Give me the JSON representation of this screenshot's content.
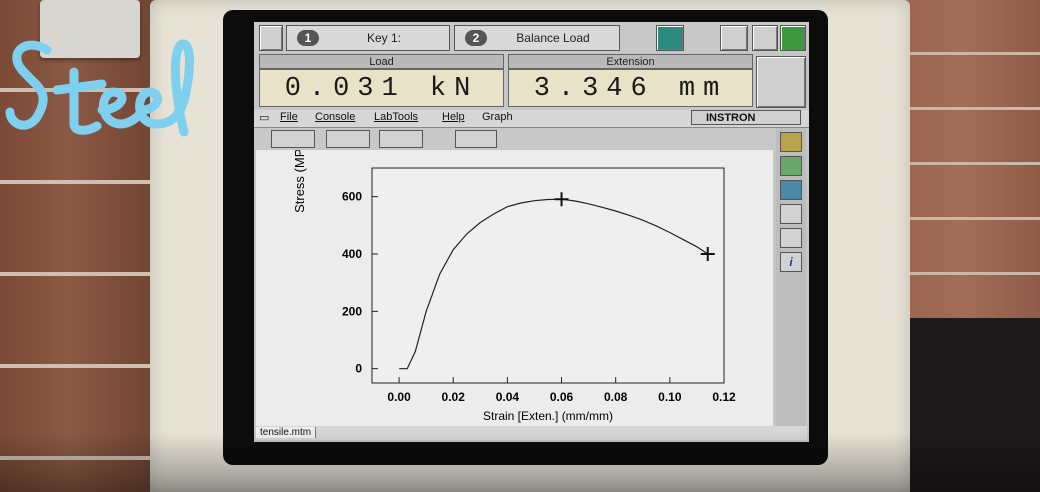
{
  "overlay": {
    "handwritten_text": "Steel"
  },
  "toolbar": {
    "key1_number": "1",
    "key1_label": "Key 1:",
    "key2_number": "2",
    "key2_label": "Balance Load"
  },
  "readouts": {
    "load_title": "Load",
    "load_value": "0.031 kN",
    "extension_title": "Extension",
    "extension_value": "3.346 mm"
  },
  "menu": {
    "items": [
      "File",
      "Console",
      "LabTools",
      "Help",
      "Graph"
    ],
    "instrument": "INSTRON"
  },
  "status": {
    "file": "tensile.mtm"
  },
  "chart_data": {
    "type": "line",
    "xlabel": "Strain [Exten.] (mm/mm)",
    "ylabel": "Stress (MPa)",
    "xlim": [
      -0.01,
      0.12
    ],
    "ylim": [
      -50,
      700
    ],
    "xticks": [
      "0.00",
      "0.02",
      "0.04",
      "0.06",
      "0.08",
      "0.10",
      "0.12"
    ],
    "yticks": [
      "0",
      "200",
      "400",
      "600"
    ],
    "series": [
      {
        "x": [
          0.0,
          0.003,
          0.006,
          0.01,
          0.015,
          0.02,
          0.025,
          0.03,
          0.035,
          0.04,
          0.045,
          0.05,
          0.055,
          0.06,
          0.065,
          0.07,
          0.075,
          0.08,
          0.085,
          0.09,
          0.095,
          0.1,
          0.105,
          0.11,
          0.114
        ],
        "y": [
          0,
          0,
          60,
          200,
          330,
          415,
          470,
          510,
          540,
          565,
          578,
          586,
          590,
          591,
          585,
          575,
          563,
          550,
          535,
          518,
          498,
          475,
          450,
          425,
          400
        ]
      }
    ],
    "markers": [
      {
        "x": 0.06,
        "y": 591
      },
      {
        "x": 0.114,
        "y": 400
      }
    ]
  }
}
